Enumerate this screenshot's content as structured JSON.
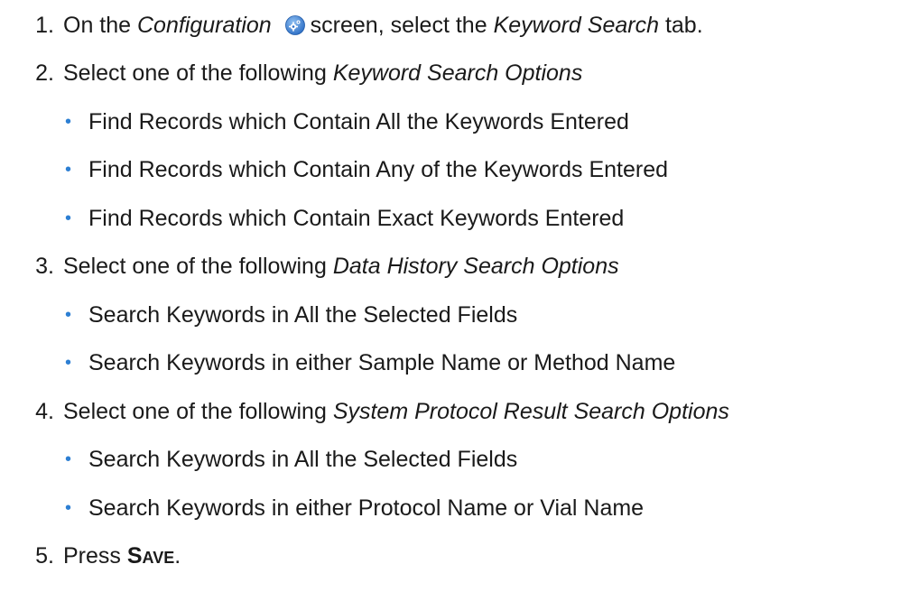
{
  "steps": [
    {
      "number": "1.",
      "parts": {
        "a": "On the ",
        "b": "Configuration",
        "c": "screen, select the ",
        "d": "Keyword Search",
        "e": " tab."
      }
    },
    {
      "number": "2.",
      "parts": {
        "a": "Select one of the following ",
        "b": "Keyword Search Options"
      },
      "bullets": [
        "Find Records which Contain All the Keywords Entered",
        "Find Records which Contain Any of the Keywords Entered",
        "Find Records which Contain Exact Keywords Entered"
      ]
    },
    {
      "number": "3.",
      "parts": {
        "a": "Select one of the following ",
        "b": "Data History Search Options"
      },
      "bullets": [
        "Search Keywords in All the Selected Fields",
        "Search Keywords in either Sample Name or Method Name"
      ]
    },
    {
      "number": "4.",
      "parts": {
        "a": "Select one of the following ",
        "b": "System Protocol Result Search Options"
      },
      "bullets": [
        "Search Keywords in All the Selected Fields",
        "Search Keywords in either Protocol Name or Vial Name"
      ]
    },
    {
      "number": "5.",
      "parts": {
        "a": "Press ",
        "b": "Save",
        "c": "."
      }
    }
  ],
  "bullet_glyph": "•",
  "icons": {
    "configuration": "gear-icon"
  },
  "colors": {
    "text": "#1a1a1a",
    "bullet": "#2d7fd3",
    "icon_blue": "#3a7fd6"
  }
}
